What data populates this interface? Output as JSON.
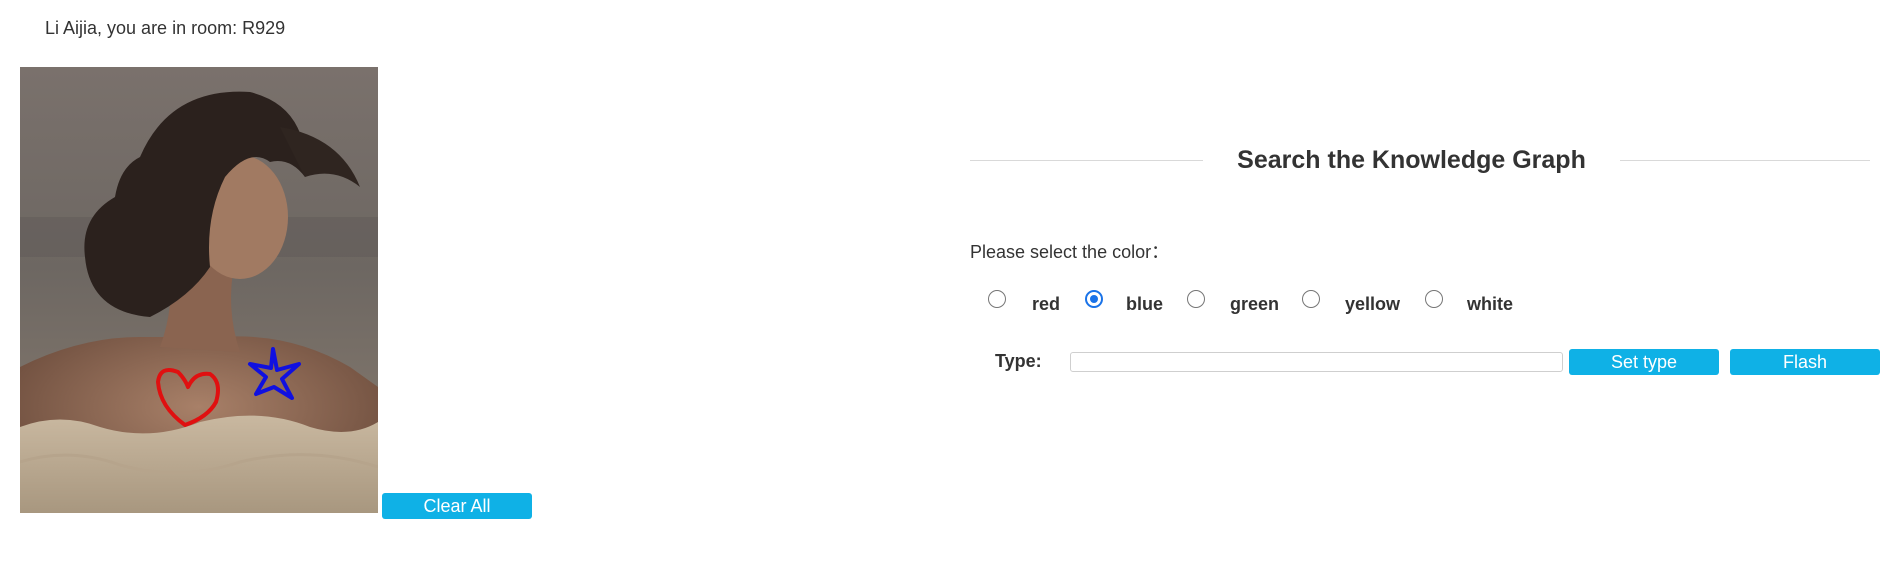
{
  "header": {
    "room_text": "Li Aijia, you are in room: R929"
  },
  "canvas": {
    "clear_label": "Clear All",
    "strokes": [
      "red heart",
      "blue star"
    ],
    "stroke_colors": {
      "heart": "#e01010",
      "star": "#1010e0"
    }
  },
  "search": {
    "title": "Search the Knowledge Graph",
    "select_label": "Please select the color：",
    "colors": [
      {
        "label": "red",
        "checked": false
      },
      {
        "label": "blue",
        "checked": true
      },
      {
        "label": "green",
        "checked": false
      },
      {
        "label": "yellow",
        "checked": false
      },
      {
        "label": "white",
        "checked": false
      }
    ],
    "type_label": "Type:",
    "type_value": "",
    "set_type_label": "Set type",
    "flash_label": "Flash"
  },
  "colors": {
    "button_bg": "#0fb1e6",
    "radio_checked": "#1a73e8"
  }
}
